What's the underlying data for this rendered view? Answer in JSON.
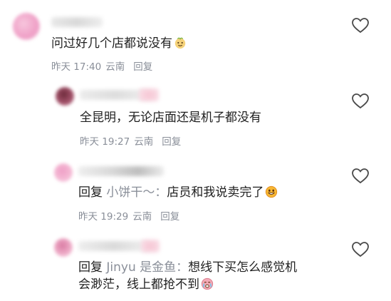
{
  "comments": [
    {
      "text": "问过好几个店都说没有",
      "emoji": "smiling-face-emoji",
      "time": "昨天 17:40",
      "location": "云南",
      "reply_label": "回复"
    },
    {
      "text": "全昆明，无论店面还是机子都没有",
      "time": "昨天 19:27",
      "location": "云南",
      "reply_label": "回复"
    },
    {
      "reply_prefix": "回复",
      "mention": "小饼干～：",
      "text": "店员和我说卖完了",
      "emoji": "grinning-face-emoji",
      "time": "昨天 19:29",
      "location": "云南",
      "reply_label": "回复"
    },
    {
      "reply_prefix": "回复",
      "mention": "Jinyu 是金鱼：",
      "text_line1": "想线下买怎么感觉机",
      "text_line2": "会渺茫，线上都抢不到",
      "emoji": "crying-face-emoji"
    }
  ],
  "colors": {
    "text": "#1f1f1f",
    "meta": "#8a8f99",
    "like_outline": "#4a4a4a"
  }
}
